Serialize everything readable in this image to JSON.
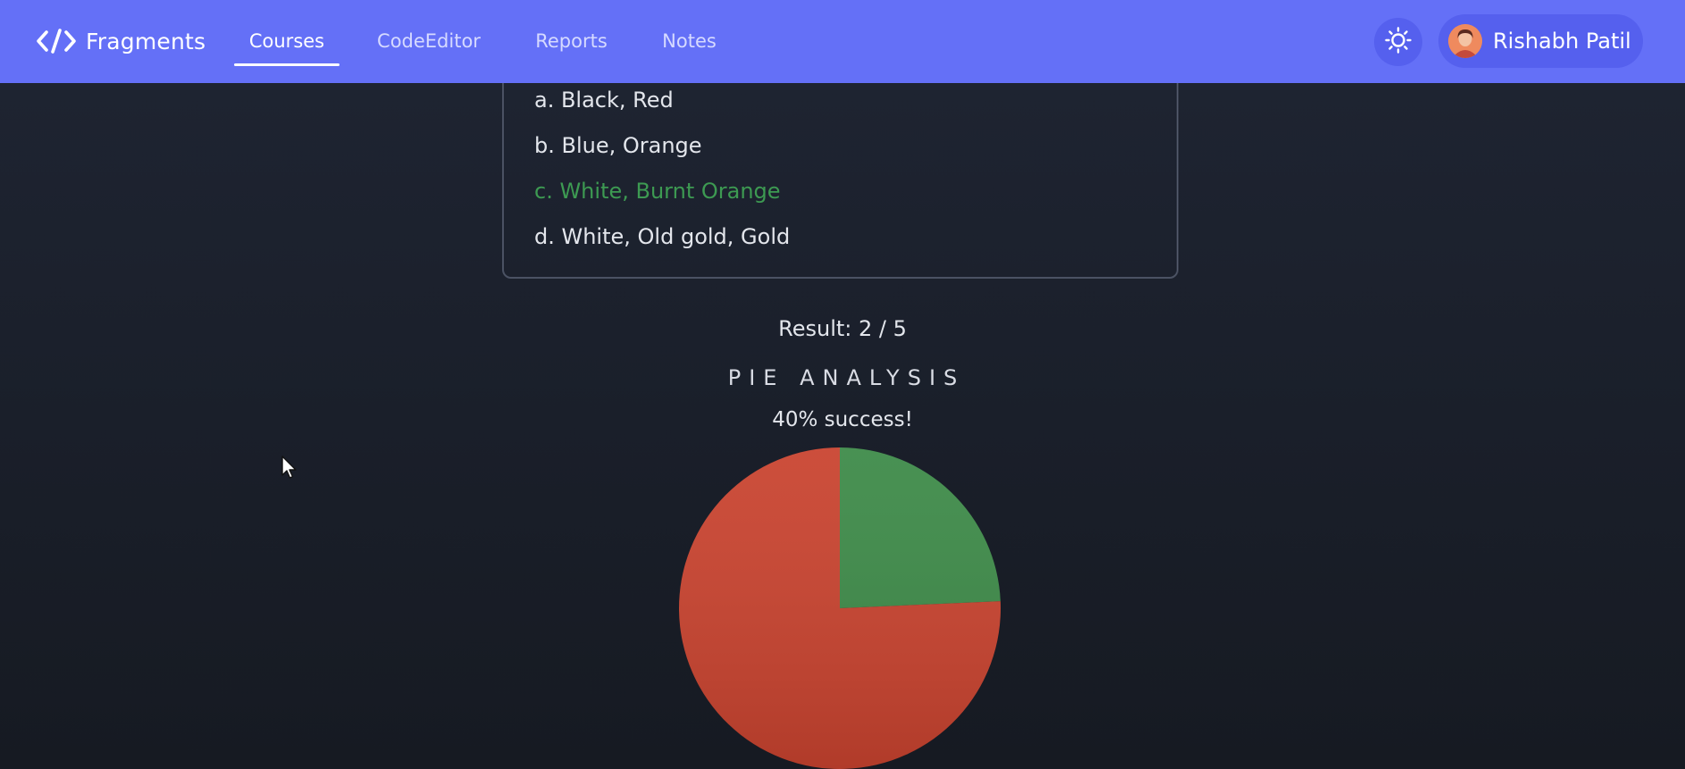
{
  "nav": {
    "brand": "Fragments",
    "items": [
      {
        "label": "Courses",
        "active": true
      },
      {
        "label": "CodeEditor",
        "active": false
      },
      {
        "label": "Reports",
        "active": false
      },
      {
        "label": "Notes",
        "active": false
      }
    ],
    "theme_icon": "sun-icon",
    "user_name": "Rishabh Patil"
  },
  "quiz": {
    "options": [
      {
        "text": "a. Black, Red",
        "correct": false
      },
      {
        "text": "b. Blue, Orange",
        "correct": false
      },
      {
        "text": "c. White, Burnt Orange",
        "correct": true
      },
      {
        "text": "d. White, Old gold, Gold",
        "correct": false
      }
    ]
  },
  "result": {
    "text": "Result: 2 / 5"
  },
  "chart_data": {
    "type": "pie",
    "title": "PIE ANALYSIS",
    "subtitle": "40% success!",
    "slices": [
      {
        "value": 24.3,
        "color": "#3d8a48"
      },
      {
        "value": 75.7,
        "color": "#c9432f"
      }
    ]
  },
  "colors": {
    "nav_bg": "#6470f7",
    "correct": "#3d9a52",
    "page_bg": "#1d2230"
  }
}
